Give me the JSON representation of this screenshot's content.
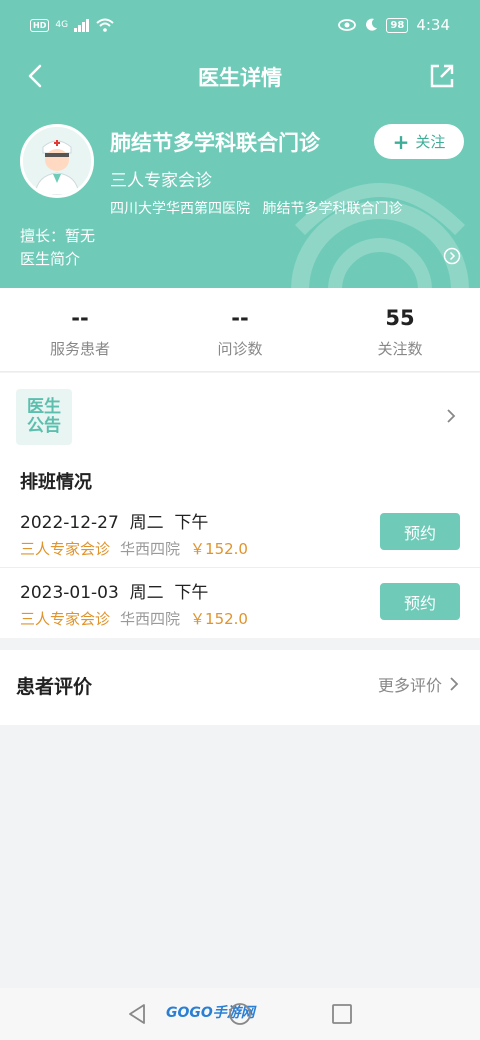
{
  "status_bar": {
    "hd_label": "HD",
    "network": "4G",
    "battery": "98",
    "time": "4:34"
  },
  "nav": {
    "title": "医生详情"
  },
  "doctor": {
    "name": "肺结节多学科联合门诊",
    "title": "三人专家会诊",
    "hospital": "四川大学华西第四医院",
    "department": "肺结节多学科联合门诊",
    "specialty": "擅长：暂无",
    "intro_label": "医生简介",
    "follow_plus": "+",
    "follow_label": "关注"
  },
  "stats": [
    {
      "value": "--",
      "label": "服务患者"
    },
    {
      "value": "--",
      "label": "问诊数"
    },
    {
      "value": "55",
      "label": "关注数"
    }
  ],
  "notice": {
    "line1": "医生",
    "line2": "公告"
  },
  "schedule": {
    "title": "排班情况",
    "rows": [
      {
        "date": "2022-12-27  周二  下午",
        "type": "三人专家会诊",
        "hospital": "华西四院",
        "price": "￥152.0",
        "button": "预约"
      },
      {
        "date": "2023-01-03  周二  下午",
        "type": "三人专家会诊",
        "hospital": "华西四院",
        "price": "￥152.0",
        "button": "预约"
      }
    ]
  },
  "reviews": {
    "title": "患者评价",
    "more": "更多评价"
  },
  "watermark": {
    "logo_text": "GOGO手游网"
  },
  "colors": {
    "accent": "#6fcbb8",
    "price": "#e0942e"
  }
}
